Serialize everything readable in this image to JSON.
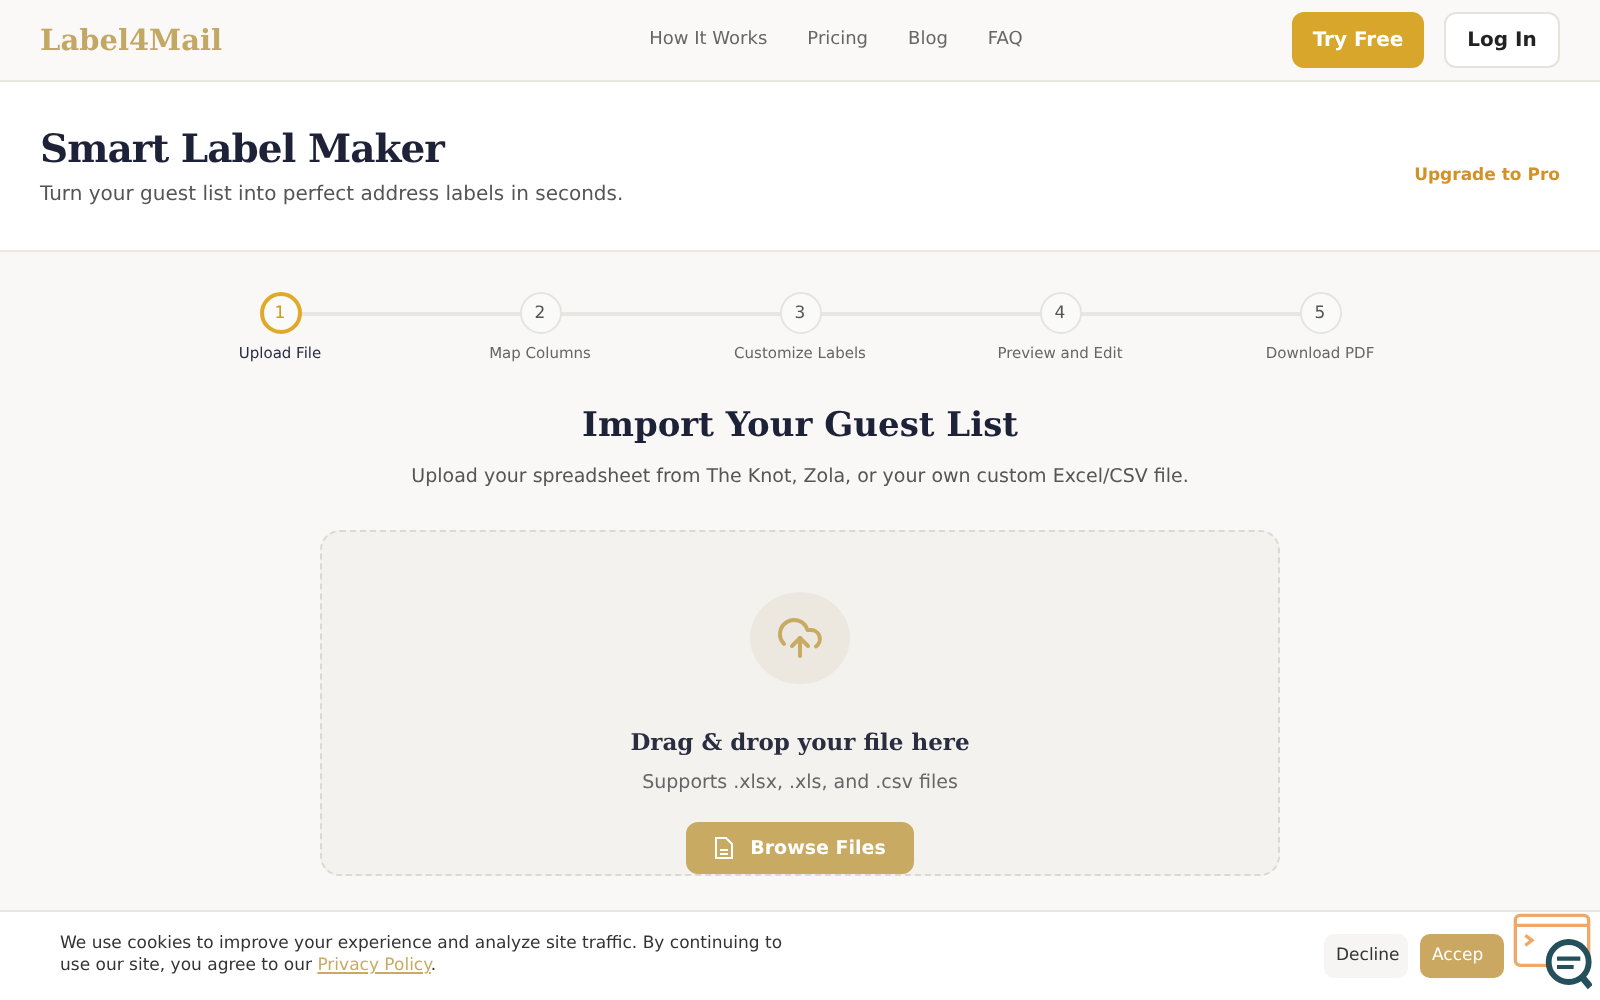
{
  "header": {
    "logo": "Label4Mail",
    "nav": [
      "How It Works",
      "Pricing",
      "Blog",
      "FAQ"
    ],
    "try_button": "Try Free",
    "login_button": "Log In"
  },
  "hero": {
    "title": "Smart Label Maker",
    "subtitle": "Turn your guest list into perfect address labels in seconds.",
    "upgrade_link": "Upgrade to Pro"
  },
  "steps": [
    {
      "number": "1",
      "label": "Upload File",
      "selected": true
    },
    {
      "number": "2",
      "label": "Map Columns",
      "selected": false
    },
    {
      "number": "3",
      "label": "Customize Labels",
      "selected": false
    },
    {
      "number": "4",
      "label": "Preview and Edit",
      "selected": false
    },
    {
      "number": "5",
      "label": "Download PDF",
      "selected": false
    }
  ],
  "import": {
    "title": "Import Your Guest List",
    "subtitle": "Upload your spreadsheet from The Knot, Zola, or your own custom Excel/CSV file.",
    "drop_title": "Drag & drop your file here",
    "drop_hint": "Supports .xlsx, .xls, and .csv files",
    "browse_button": "Browse Files"
  },
  "cookie": {
    "text_before": "We use cookies to improve your experience and analyze site traffic. By continuing to use our site, you agree to our ",
    "link": "Privacy Policy",
    "text_after": ".",
    "decline": "Decline",
    "accept": "Accep"
  }
}
